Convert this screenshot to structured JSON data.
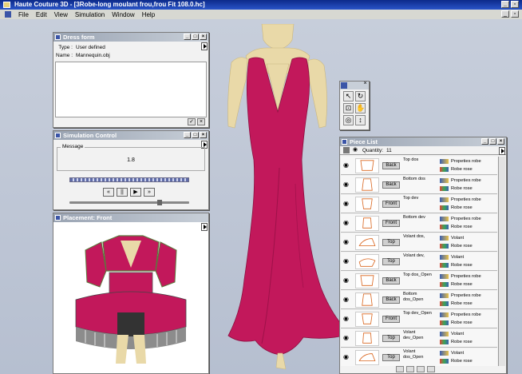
{
  "window": {
    "title": "Haute Couture 3D - [3Robe-long moulant frou,frou Fit 108.0.hc]",
    "menu": [
      "File",
      "Edit",
      "View",
      "Simulation",
      "Window",
      "Help"
    ]
  },
  "dress_form": {
    "title": "Dress form",
    "rows": [
      {
        "key": "Type :",
        "value": "User defined"
      },
      {
        "key": "Name :",
        "value": "Mannequin.obj"
      }
    ]
  },
  "simulation": {
    "title": "Simulation Control",
    "message_label": "Message",
    "message_value": "1.8",
    "controls": [
      "«",
      "||",
      "▶",
      "»"
    ]
  },
  "placement": {
    "title": "Placement: Front"
  },
  "piece_list": {
    "title": "Piece List",
    "quantity_label": "Quantity:",
    "quantity_value": "11",
    "items": [
      {
        "tag": "Back",
        "name": "Top dos",
        "prop1": "Propeties robe",
        "prop2": "Robe rose"
      },
      {
        "tag": "Back",
        "name": "Bottom dos",
        "prop1": "Propeties robe",
        "prop2": "Robe rose"
      },
      {
        "tag": "Front",
        "name": "Top dev",
        "prop1": "Propeties robe",
        "prop2": "Robe rose"
      },
      {
        "tag": "Front",
        "name": "Bottom dev",
        "prop1": "Propeties robe",
        "prop2": "Robe rose"
      },
      {
        "tag": "Top",
        "name": "Volant dos,",
        "prop1": "Volant",
        "prop2": "Robe rose"
      },
      {
        "tag": "Top",
        "name": "Volant dev,",
        "prop1": "Volant",
        "prop2": "Robe rose"
      },
      {
        "tag": "Back",
        "name": "Top dos_Open",
        "prop1": "Propeties robe",
        "prop2": "Robe rose"
      },
      {
        "tag": "Back",
        "name": "Bottom dos_Open",
        "prop1": "Propeties robe",
        "prop2": "Robe rose"
      },
      {
        "tag": "Front",
        "name": "Top dev_Open",
        "prop1": "Propeties robe",
        "prop2": "Robe rose"
      },
      {
        "tag": "Top",
        "name": "Volant dev_Open",
        "prop1": "Volant",
        "prop2": "Robe rose"
      },
      {
        "tag": "Top",
        "name": "Volant dos_Open",
        "prop1": "Volant",
        "prop2": "Robe rose"
      }
    ]
  },
  "colors": {
    "dress": "#c2185b",
    "skin": "#e9d9a8",
    "workspace": "#c7cedb"
  }
}
